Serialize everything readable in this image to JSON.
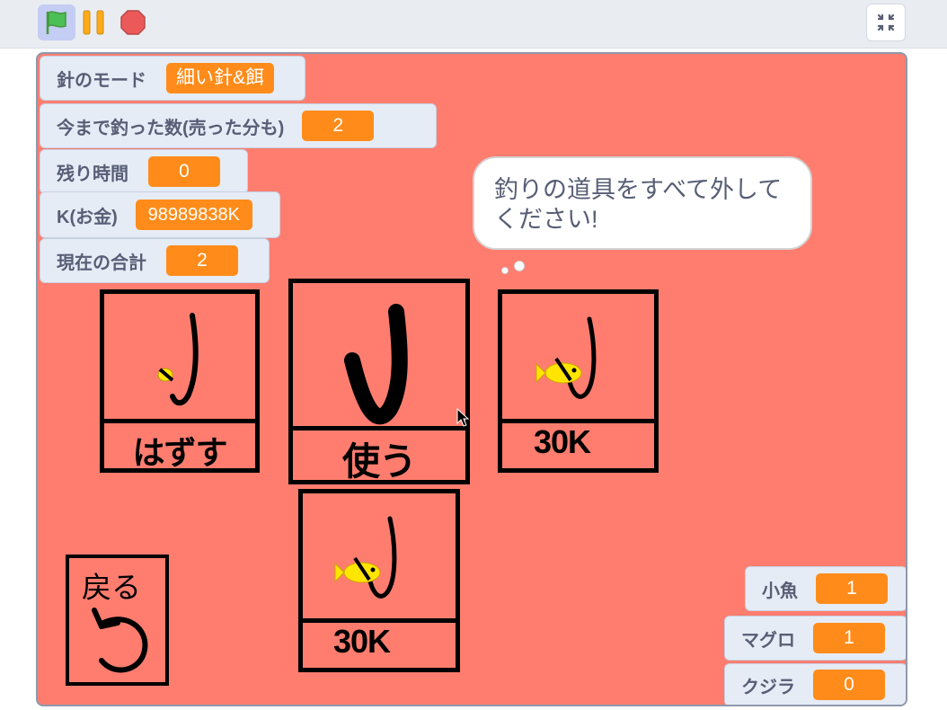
{
  "toolbar": {
    "green_flag_icon": "green-flag-icon",
    "pause_icon": "pause-icon",
    "stop_icon": "stop-icon",
    "fullscreen_icon": "exit-fullscreen-icon",
    "flag_color": "#4cbf56",
    "pause_color": "#ffab19",
    "stop_color": "#ec5959"
  },
  "stage": {
    "background": "#fe7d6f",
    "monitors": [
      {
        "label": "針のモード",
        "value": "細い針&餌"
      },
      {
        "label": "今まで釣った数(売った分も)",
        "value": "2"
      },
      {
        "label": "残り時間",
        "value": "0"
      },
      {
        "label": "K(お金)",
        "value": "98989838K"
      },
      {
        "label": "現在の合計",
        "value": "2"
      }
    ],
    "fish_monitors": [
      {
        "label": "小魚",
        "value": "1"
      },
      {
        "label": "マグロ",
        "value": "1"
      },
      {
        "label": "クジラ",
        "value": "0"
      }
    ],
    "speech_bubble": "釣りの道具をすべて外してください!",
    "cards": [
      {
        "label": "はずす",
        "icon": "thin-hook-with-bait-icon"
      },
      {
        "label": "使う",
        "icon": "thick-hook-icon"
      },
      {
        "label": "30K",
        "icon": "hook-with-fish-icon"
      },
      {
        "label": "30K",
        "icon": "hook-with-fish-icon"
      }
    ],
    "back_button": {
      "label": "戻る",
      "icon": "undo-arrow-icon"
    }
  }
}
